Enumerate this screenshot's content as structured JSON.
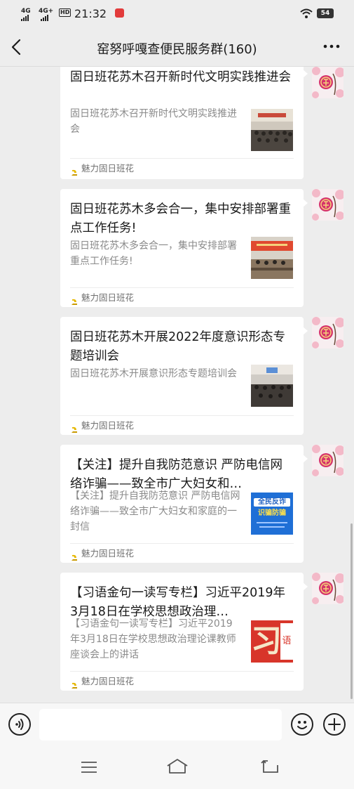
{
  "status_bar": {
    "signal1": "4G",
    "signal2": "4G+",
    "hd": "HD",
    "time": "21:32",
    "battery": "54",
    "icons": [
      "signal-icon",
      "hd-icon",
      "app-notification-icon",
      "wifi-icon",
      "battery-icon"
    ]
  },
  "nav": {
    "title": "窑努呼嘎查便民服务群(160)",
    "back_icon": "chevron-left-icon",
    "more_icon": "more-dots-icon"
  },
  "messages": [
    {
      "title": "固日班花苏木召开新时代文明实践推进会",
      "description": "固日班花苏木召开新时代文明实践推进会",
      "source": "魅力固日班花",
      "thumb_kind": "meeting-photo"
    },
    {
      "title": "固日班花苏木多会合一，集中安排部署重点工作任务!",
      "description": "固日班花苏木多会合一，集中安排部署重点工作任务!",
      "source": "魅力固日班花",
      "thumb_kind": "meeting-banner-photo"
    },
    {
      "title": "固日班花苏木开展2022年度意识形态专题培训会",
      "description": "固日班花苏木开展意识形态专题培训会",
      "source": "魅力固日班花",
      "thumb_kind": "meeting-photo"
    },
    {
      "title": "【关注】提升自我防范意识 严防电信网络诈骗——致全市广大妇女和…",
      "description": "【关注】提升自我防范意识 严防电信网络诈骗——致全市广大妇女和家庭的一封信",
      "source": "魅力固日班花",
      "thumb_kind": "anti-fraud-poster",
      "thumb_text_1": "全民反诈",
      "thumb_text_2": "识骗防骗"
    },
    {
      "title": "【习语金句一读写专栏】习近平2019年3月18日在学校思想政治理…",
      "description": "【习语金句一读写专栏】习近平2019年3月18日在学校思想政治理论课教师座谈会上的讲话",
      "source": "魅力固日班花",
      "thumb_kind": "xi-calligraphy",
      "thumb_text_1": "习",
      "thumb_text_2": "语"
    }
  ],
  "avatar_icon": "fortune-flower-avatar",
  "input_bar": {
    "voice_icon": "voice-icon",
    "emoji_icon": "emoji-icon",
    "plus_icon": "plus-icon",
    "placeholder": ""
  },
  "system_nav": {
    "icons": [
      "menu-icon",
      "home-icon",
      "back-icon"
    ]
  },
  "colors": {
    "background": "#ededed",
    "card": "#ffffff",
    "title_text": "#191919",
    "desc_text": "#8a8a8a",
    "source_text": "#707070",
    "source_icon": "#e6b800"
  }
}
